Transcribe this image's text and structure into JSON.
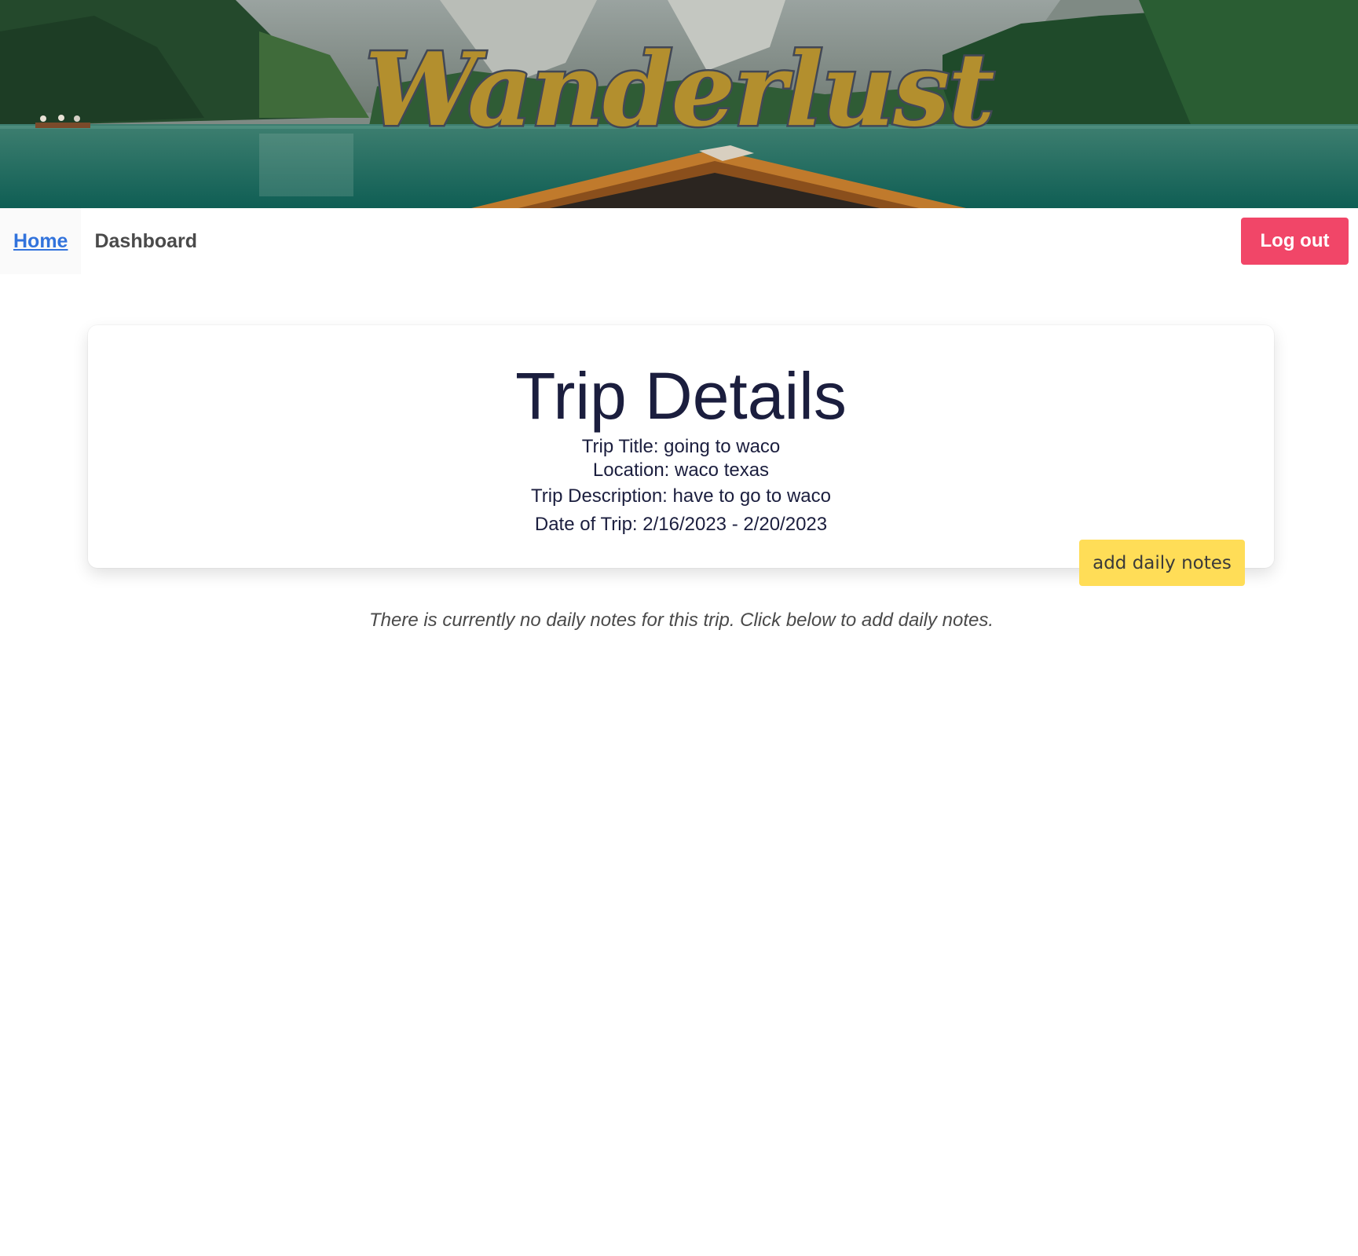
{
  "brand": {
    "name": "Wanderlust"
  },
  "nav": {
    "home_label": "Home",
    "dashboard_label": "Dashboard",
    "logout_label": "Log out"
  },
  "trip": {
    "heading": "Trip Details",
    "title_line": "Trip Title: going to waco",
    "location_line": "Location: waco texas",
    "description_line": "Trip Description: have to go to waco",
    "date_line": "Date of Trip: 2/16/2023 - 2/20/2023"
  },
  "actions": {
    "add_daily_notes_label": "add daily notes"
  },
  "notes": {
    "empty_message": "There is currently no daily notes for this trip. Click below to add daily notes."
  },
  "colors": {
    "logout_bg": "#f14668",
    "add_notes_bg": "#ffdd57",
    "brand_gold": "#b38f2e",
    "heading_navy": "#1b1e3e",
    "link_blue": "#3273dc"
  },
  "icons": {
    "hero": "mountain-lake-boat-banner"
  }
}
